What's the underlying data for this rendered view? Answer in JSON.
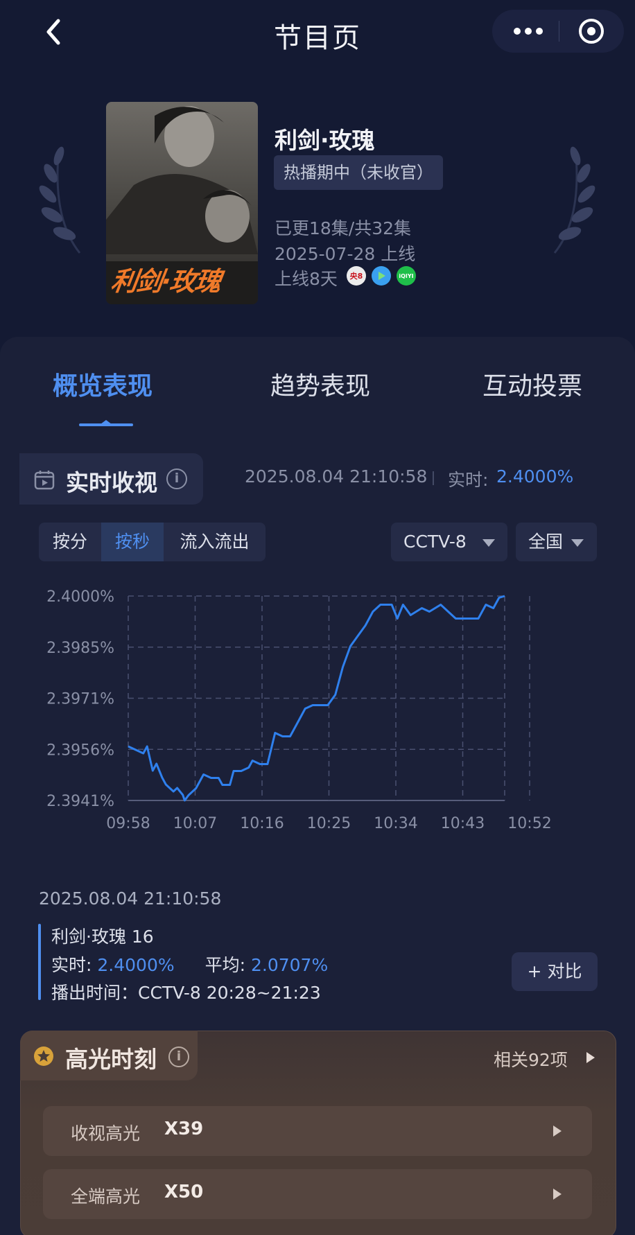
{
  "header": {
    "title": "节目页"
  },
  "show": {
    "title": "利剑·玫瑰",
    "status": "热播期中（未收官）",
    "episodes": "已更18集/共32集",
    "air_date": "2025-07-28 上线",
    "days_online": "上线8天",
    "poster_text": "利剑·玫瑰",
    "platforms": [
      {
        "name": "cctv8-icon",
        "label": "央8",
        "color": "#e8e8e8"
      },
      {
        "name": "tencent-video-icon",
        "label": "",
        "color": "#3aa0f0"
      },
      {
        "name": "iqiyi-icon",
        "label": "iQIYI",
        "color": "#1fbf4a"
      }
    ]
  },
  "tabs": [
    {
      "label": "概览表现",
      "active": true
    },
    {
      "label": "趋势表现",
      "active": false
    },
    {
      "label": "互动投票",
      "active": false
    }
  ],
  "realtime": {
    "title": "实时收视",
    "timestamp": "2025.08.04 21:10:58",
    "label": "实时:",
    "value": "2.4000%"
  },
  "segments": [
    {
      "label": "按分",
      "active": false
    },
    {
      "label": "按秒",
      "active": true
    },
    {
      "label": "流入流出",
      "active": false
    }
  ],
  "dropdowns": {
    "channel": "CCTV-8",
    "region": "全国"
  },
  "chart_data": {
    "type": "line",
    "series_color": "#2f80ed",
    "y_ticks": [
      "2.4000%",
      "2.3985%",
      "2.3971%",
      "2.3956%",
      "2.3941%"
    ],
    "ylim": [
      2.3941,
      2.4
    ],
    "x_ticks": [
      "09:58",
      "10:07",
      "10:16",
      "10:25",
      "10:34",
      "10:43",
      "10:52"
    ],
    "grid": true,
    "points": [
      [
        0,
        2.39566
      ],
      [
        0.02,
        2.39556
      ],
      [
        0.04,
        2.39546
      ],
      [
        0.05,
        2.39566
      ],
      [
        0.065,
        2.39496
      ],
      [
        0.075,
        2.39516
      ],
      [
        0.09,
        2.39476
      ],
      [
        0.1,
        2.39456
      ],
      [
        0.12,
        2.39436
      ],
      [
        0.13,
        2.39446
      ],
      [
        0.145,
        2.39426
      ],
      [
        0.15,
        2.3941
      ],
      [
        0.16,
        2.39425
      ],
      [
        0.18,
        2.39445
      ],
      [
        0.2,
        2.39485
      ],
      [
        0.22,
        2.39475
      ],
      [
        0.24,
        2.39475
      ],
      [
        0.25,
        2.39455
      ],
      [
        0.27,
        2.39455
      ],
      [
        0.28,
        2.39495
      ],
      [
        0.3,
        2.39495
      ],
      [
        0.32,
        2.39505
      ],
      [
        0.33,
        2.39525
      ],
      [
        0.35,
        2.39515
      ],
      [
        0.37,
        2.39515
      ],
      [
        0.39,
        2.39605
      ],
      [
        0.41,
        2.39595
      ],
      [
        0.43,
        2.39595
      ],
      [
        0.45,
        2.39635
      ],
      [
        0.47,
        2.39675
      ],
      [
        0.49,
        2.39685
      ],
      [
        0.51,
        2.39685
      ],
      [
        0.53,
        2.39685
      ],
      [
        0.55,
        2.39715
      ],
      [
        0.57,
        2.39795
      ],
      [
        0.59,
        2.39855
      ],
      [
        0.61,
        2.39885
      ],
      [
        0.63,
        2.39915
      ],
      [
        0.65,
        2.39955
      ],
      [
        0.67,
        2.39975
      ],
      [
        0.7,
        2.39975
      ],
      [
        0.715,
        2.39935
      ],
      [
        0.73,
        2.39975
      ],
      [
        0.75,
        2.39945
      ],
      [
        0.78,
        2.39965
      ],
      [
        0.8,
        2.39955
      ],
      [
        0.83,
        2.39975
      ],
      [
        0.85,
        2.39955
      ],
      [
        0.87,
        2.39935
      ],
      [
        0.9,
        2.39935
      ],
      [
        0.93,
        2.39935
      ],
      [
        0.95,
        2.39975
      ],
      [
        0.97,
        2.39965
      ],
      [
        0.985,
        2.39995
      ],
      [
        1.0,
        2.4
      ]
    ]
  },
  "detail": {
    "timestamp": "2025.08.04 21:10:58",
    "episode": "利剑·玫瑰 16",
    "realtime_label": "实时:",
    "realtime_value": "2.4000%",
    "avg_label": "平均:",
    "avg_value": "2.0707%",
    "broadcast": "播出时间：CCTV-8 20:28~21:23",
    "compare": "+ 对比"
  },
  "highlights": {
    "title": "高光时刻",
    "related": "相关92项",
    "rows": [
      {
        "label": "收视高光",
        "value": "X39"
      },
      {
        "label": "全端高光",
        "value": "X50"
      }
    ]
  }
}
